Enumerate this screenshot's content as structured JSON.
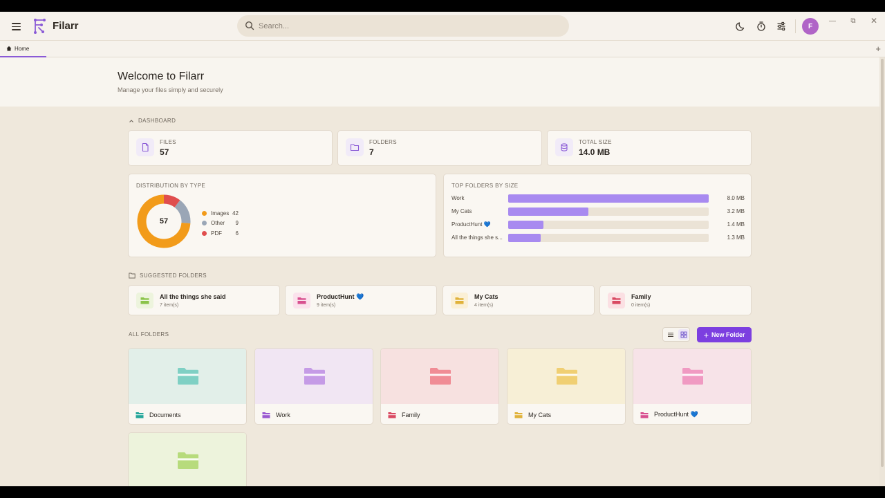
{
  "app": {
    "name": "Filarr",
    "avatar_initial": "F"
  },
  "search": {
    "placeholder": "Search..."
  },
  "tabs": [
    {
      "label": "Home"
    }
  ],
  "welcome": {
    "title": "Welcome to Filarr",
    "subtitle": "Manage your files simply and securely"
  },
  "dashboard": {
    "label": "DASHBOARD",
    "stats": [
      {
        "label": "FILES",
        "value": "57",
        "icon": "file-icon"
      },
      {
        "label": "FOLDERS",
        "value": "7",
        "icon": "folder-icon"
      },
      {
        "label": "TOTAL SIZE",
        "value": "14.0 MB",
        "icon": "database-icon"
      }
    ],
    "distribution": {
      "title": "DISTRIBUTION BY TYPE",
      "total": "57",
      "items": [
        {
          "name": "Images",
          "count": "42",
          "value": 42,
          "color": "#f29b1a"
        },
        {
          "name": "Other",
          "count": "9",
          "value": 9,
          "color": "#9aa6b6"
        },
        {
          "name": "PDF",
          "count": "6",
          "value": 6,
          "color": "#e04e4e"
        }
      ]
    },
    "top_folders": {
      "title": "TOP FOLDERS BY SIZE",
      "rows": [
        {
          "name": "Work",
          "size": "8.0 MB",
          "mb": 8.0
        },
        {
          "name": "My Cats",
          "size": "3.2 MB",
          "mb": 3.2
        },
        {
          "name": "ProductHunt 💙",
          "size": "1.4 MB",
          "mb": 1.4
        },
        {
          "name": "All the things she s...",
          "size": "1.3 MB",
          "mb": 1.3
        }
      ],
      "max_mb": 8.0,
      "bar_color": "#a88af0"
    }
  },
  "suggested": {
    "label": "SUGGESTED FOLDERS",
    "items": [
      {
        "name": "All the things she said",
        "count": "7 item(s)",
        "color": "#8bc34a",
        "bg": "#edf4dd"
      },
      {
        "name": "ProductHunt 💙",
        "count": "9 item(s)",
        "color": "#d8508f",
        "bg": "#fbe2ec"
      },
      {
        "name": "My Cats",
        "count": "4 item(s)",
        "color": "#e0b23a",
        "bg": "#fbf0d6"
      },
      {
        "name": "Family",
        "count": "0 item(s)",
        "color": "#d94a62",
        "bg": "#fbe0e3"
      }
    ]
  },
  "all_folders": {
    "label": "ALL FOLDERS",
    "new_folder_label": "New Folder",
    "items": [
      {
        "name": "Documents",
        "color": "#7fd0c4",
        "icon_color": "#26a69a",
        "bg": "#e2efe9"
      },
      {
        "name": "Work",
        "color": "#c59be6",
        "icon_color": "#9b59d0",
        "bg": "#f1e6f3"
      },
      {
        "name": "Family",
        "color": "#f08c95",
        "icon_color": "#d94a62",
        "bg": "#f7e1e0"
      },
      {
        "name": "My Cats",
        "color": "#f0cf73",
        "icon_color": "#e0b23a",
        "bg": "#f7efd6"
      },
      {
        "name": "ProductHunt 💙",
        "color": "#f09ac2",
        "icon_color": "#d8508f",
        "bg": "#f7e3e8"
      },
      {
        "name": "",
        "color": "#b7db7c",
        "icon_color": "#8bc34a",
        "bg": "#edf3dc"
      }
    ]
  }
}
